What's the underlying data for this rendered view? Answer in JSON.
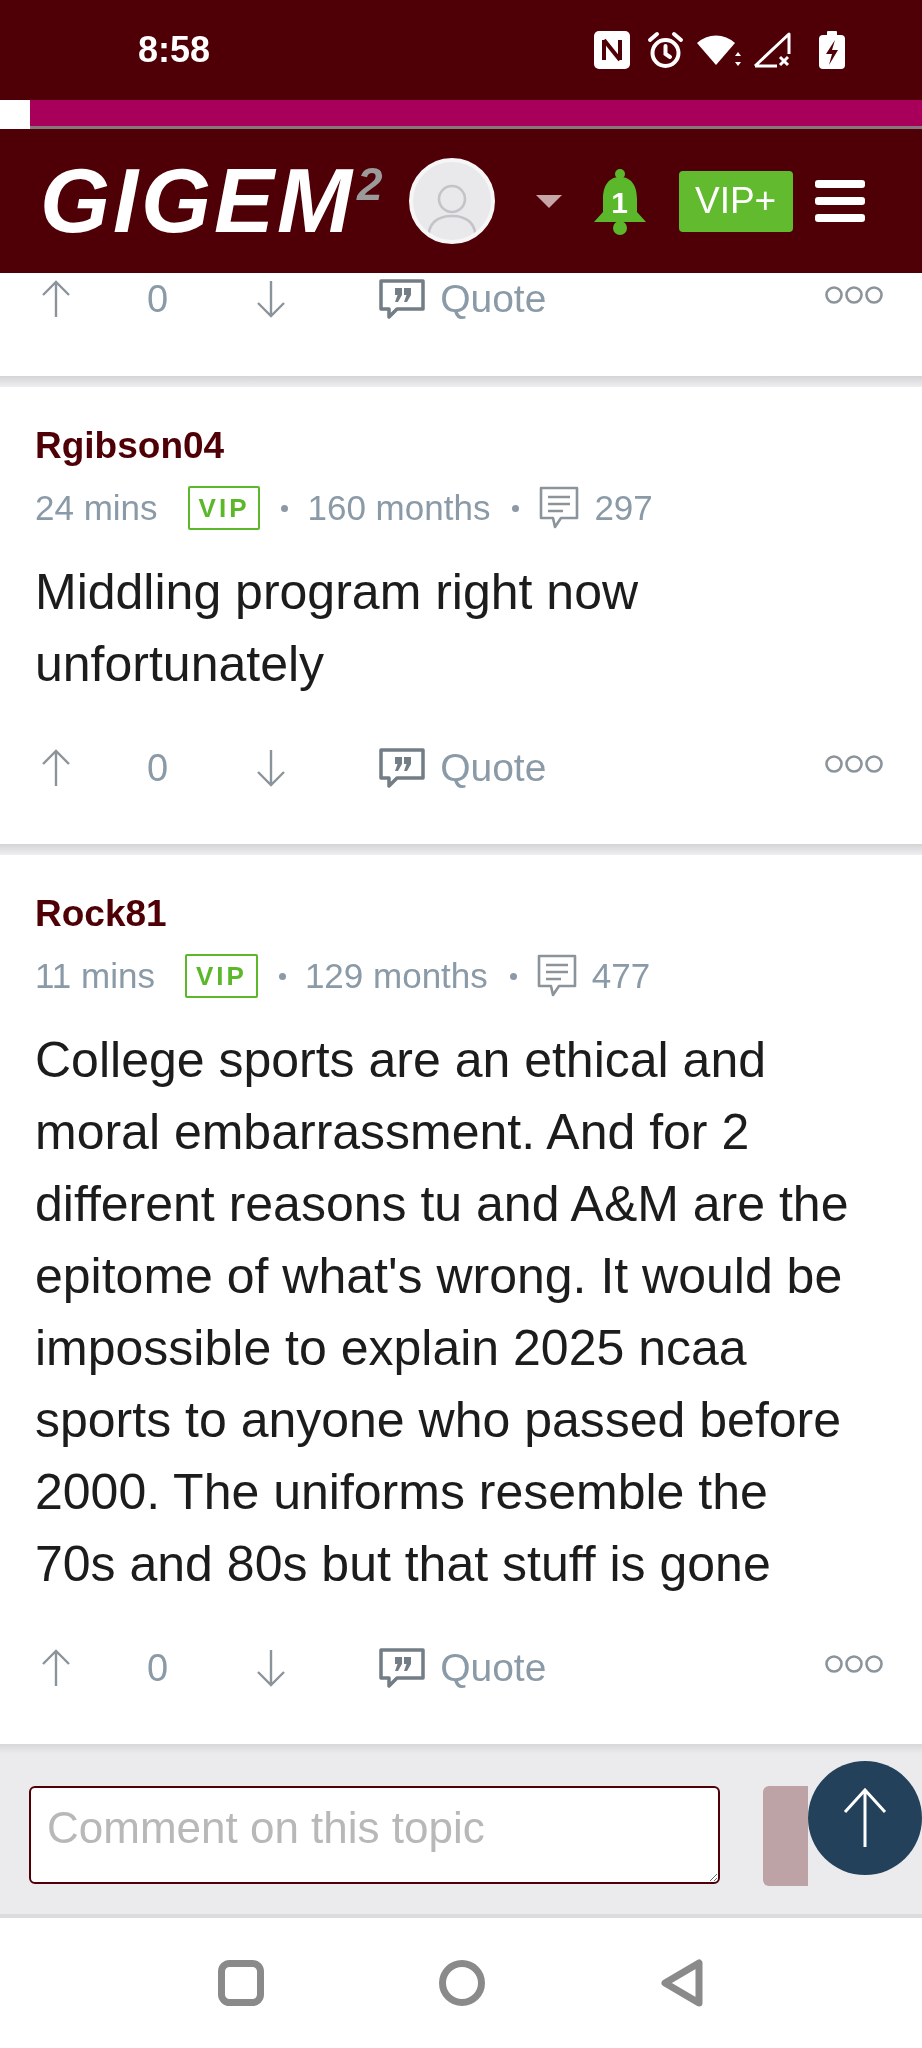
{
  "status_bar": {
    "time": "8:58"
  },
  "header": {
    "logo": {
      "text": "GIGEM",
      "superscript": "2"
    },
    "notifications": {
      "count": "1"
    },
    "vip_button": "VIP+"
  },
  "posts": [
    {
      "votes": "0",
      "quote_label": "Quote"
    },
    {
      "username": "Rgibson04",
      "time": "24 mins",
      "badge": "VIP",
      "tenure": "160 months",
      "post_count": "297",
      "body": "Middling program right now unfortunately",
      "votes": "0",
      "quote_label": "Quote"
    },
    {
      "username": "Rock81",
      "time": "11 mins",
      "badge": "VIP",
      "tenure": "129 months",
      "post_count": "477",
      "body": "College sports are an ethical and moral embarrassment. And for 2 different reasons tu and A&M are the epitome of what's wrong. It would be impossible to explain 2025 ncaa sports to anyone who passed before 2000. The uniforms resemble the 70s and 80s but that stuff is gone",
      "votes": "0",
      "quote_label": "Quote"
    }
  ],
  "comment_box": {
    "placeholder": "Comment on this topic"
  }
}
